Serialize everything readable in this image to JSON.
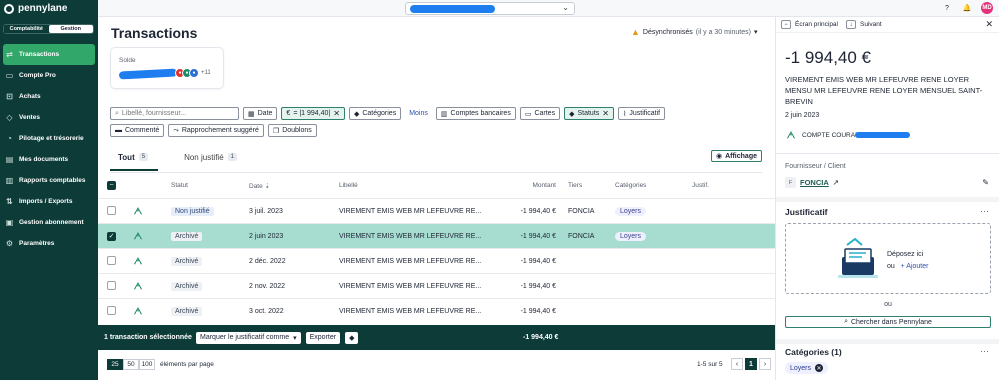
{
  "app": {
    "name": "pennylane"
  },
  "topbar": {
    "company_selector": "",
    "avatar_initials": "MD"
  },
  "sidebar": {
    "segments": [
      "Comptabilité",
      "Gestion"
    ],
    "items": [
      {
        "label": "Transactions",
        "icon": "arrows-icon",
        "active": true
      },
      {
        "label": "Compte Pro",
        "icon": "card-icon"
      },
      {
        "label": "Achats",
        "icon": "cart-icon"
      },
      {
        "label": "Ventes",
        "icon": "tag-icon"
      },
      {
        "label": "Pilotage et trésorerie",
        "icon": "chart-icon"
      },
      {
        "label": "Mes documents",
        "icon": "folder-icon"
      },
      {
        "label": "Rapports comptables",
        "icon": "report-icon"
      },
      {
        "label": "Imports / Exports",
        "icon": "transfer-icon"
      },
      {
        "label": "Gestion abonnement",
        "icon": "subscription-icon"
      },
      {
        "label": "Paramètres",
        "icon": "gear-icon"
      }
    ]
  },
  "main": {
    "title": "Transactions",
    "sync_status": "Désynchronisés",
    "sync_time": "(il y a 30 minutes)",
    "solde_label": "Solde",
    "solde_more": "+11",
    "filters": {
      "search_placeholder": "Libellé, fournisseur...",
      "date": "Date",
      "amount": "= |1 994,40|",
      "categories": "Catégories",
      "moins": "Moins",
      "comptes": "Comptes bancaires",
      "cartes": "Cartes",
      "statuts": "Statuts",
      "justificatif": "Justificatif",
      "commente": "Commenté",
      "rapprochement": "Rapprochement suggéré",
      "doublons": "Doublons"
    },
    "tabs": [
      {
        "label": "Tout",
        "count": "5"
      },
      {
        "label": "Non justifié",
        "count": "1"
      }
    ],
    "affichage": "Affichage",
    "columns": {
      "statut": "Statut",
      "date": "Date",
      "libelle": "Libellé",
      "montant": "Montant",
      "tiers": "Tiers",
      "categories": "Catégories",
      "justif": "Justif."
    },
    "rows": [
      {
        "status": "Non justifié",
        "date": "3 juil. 2023",
        "libelle": "VIREMENT EMIS WEB MR LEFEUVRE RE...",
        "montant": "-1 994,40 €",
        "tiers": "FONCIA",
        "categorie": "Loyers",
        "selected": false
      },
      {
        "status": "Archivé",
        "date": "2 juin 2023",
        "libelle": "VIREMENT EMIS WEB MR LEFEUVRE RE...",
        "montant": "-1 994,40 €",
        "tiers": "FONCIA",
        "categorie": "Loyers",
        "selected": true
      },
      {
        "status": "Archivé",
        "date": "2 déc. 2022",
        "libelle": "VIREMENT EMIS WEB MR LEFEUVRE RE...",
        "montant": "-1 994,40 €",
        "tiers": "",
        "categorie": "",
        "selected": false
      },
      {
        "status": "Archivé",
        "date": "2 nov. 2022",
        "libelle": "VIREMENT EMIS WEB MR LEFEUVRE RE...",
        "montant": "-1 994,40 €",
        "tiers": "",
        "categorie": "",
        "selected": false
      },
      {
        "status": "Archivé",
        "date": "3 oct. 2022",
        "libelle": "VIREMENT EMIS WEB MR LEFEUVRE RE...",
        "montant": "-1 994,40 €",
        "tiers": "",
        "categorie": "",
        "selected": false
      }
    ],
    "actionbar": {
      "selected_text": "1 transaction sélectionnée",
      "mark_as": "Marquer le justificatif comme",
      "export": "Exporter",
      "total": "-1 994,40 €"
    },
    "pager": {
      "sizes": [
        "25",
        "50",
        "100"
      ],
      "per_page": "éléments par page",
      "range": "1-5 sur 5",
      "page": "1"
    }
  },
  "panel": {
    "ecran_principal": "Écran principal",
    "suivant": "Suivant",
    "amount": "-1 994,40 €",
    "libelle": "VIREMENT EMIS WEB MR LEFEUVRE RENE LOYER MENSU MR LEFEUVRE RENE LOYER MENSUEL SAINT-BREVIN",
    "date": "2 juin 2023",
    "account": "COMPTE COURANT",
    "fournisseur_label": "Fournisseur / Client",
    "fournisseur_initial": "F",
    "fournisseur": "FONCIA",
    "justificatif_title": "Justificatif",
    "deposez": "Déposez ici",
    "ou_small": "ou",
    "ajouter": "+ Ajouter",
    "ou": "ou",
    "chercher": "Chercher dans Pennylane",
    "categories_title": "Catégories (1)",
    "category": "Loyers"
  }
}
